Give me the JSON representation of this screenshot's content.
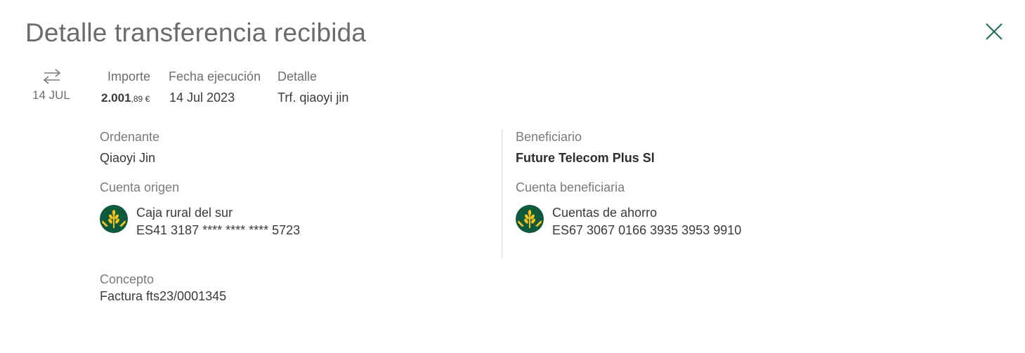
{
  "title": "Detalle transferencia recibida",
  "summary": {
    "date": "14 JUL",
    "icon": "transfer-arrows-icon"
  },
  "columns": {
    "amount_label": "Importe",
    "amount_int": "2.001",
    "amount_dec": ",89 €",
    "date_label": "Fecha ejecución",
    "date_value": "14 Jul 2023",
    "detail_label": "Detalle",
    "detail_value": "Trf. qiaoyi jin"
  },
  "ordenante": {
    "label": "Ordenante",
    "name": "Qiaoyi Jin",
    "account_label": "Cuenta origen",
    "bank_name": "Caja rural del sur",
    "iban": "ES41 3187 **** **** **** 5723"
  },
  "beneficiario": {
    "label": "Beneficiario",
    "name": "Future Telecom Plus Sl",
    "account_label": "Cuenta beneficiaria",
    "account_name": "Cuentas de ahorro",
    "iban": "ES67 3067 0166 3935 3953 9910"
  },
  "concepto": {
    "label": "Concepto",
    "value": "Factura fts23/0001345"
  },
  "colors": {
    "accent": "#1b6b5a",
    "logo_green": "#0f5a3c",
    "logo_yellow": "#f2c318"
  }
}
